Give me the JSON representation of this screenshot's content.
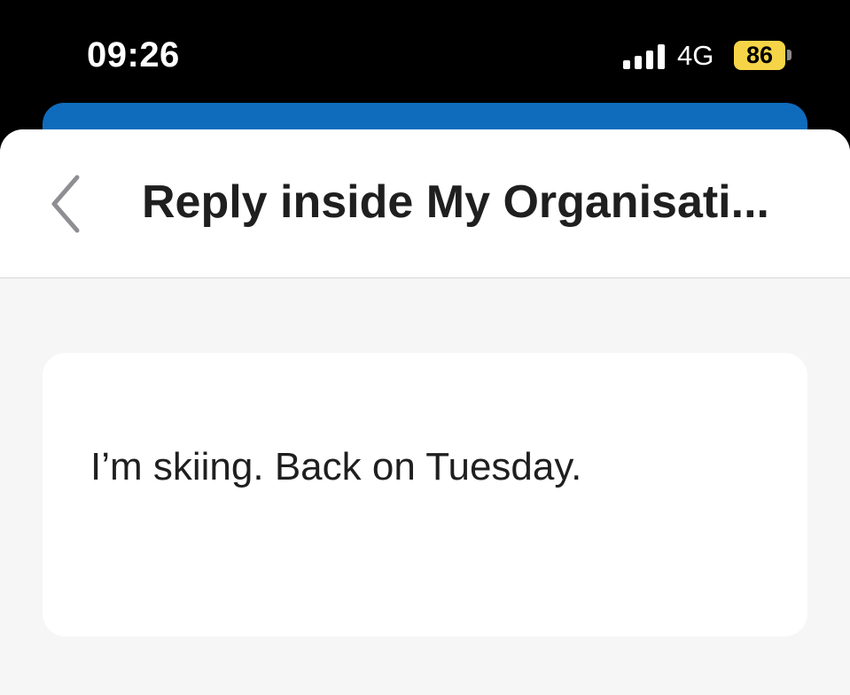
{
  "status_bar": {
    "time": "09:26",
    "network": "4G",
    "battery": "86",
    "icons": [
      "signal-icon",
      "battery-icon"
    ]
  },
  "header": {
    "back_icon": "chevron-left-icon",
    "title": "Reply inside My Organisati..."
  },
  "message": {
    "text": "I’m skiing. Back on Tuesday."
  },
  "colors": {
    "status_bar_background": "#000000",
    "back_sheet_accent": "#0f6cbd",
    "battery_fill": "#f5d547",
    "sheet_background": "#f6f6f6",
    "card_background": "#ffffff",
    "text": "#1f1f1f",
    "chevron": "#8e8e93"
  }
}
